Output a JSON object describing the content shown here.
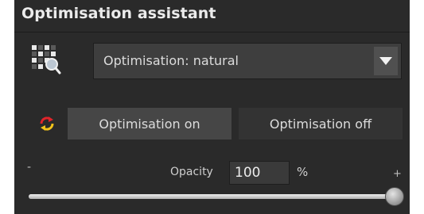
{
  "panel": {
    "title": "Optimisation assistant"
  },
  "mode_selector": {
    "icon": "magnifier-grid-icon",
    "selected": "Optimisation: natural",
    "arrow_icon": "triangle-down-icon"
  },
  "sync_icon": "sync-arrows-icon",
  "buttons": {
    "on_label": "Optimisation on",
    "off_label": "Optimisation off"
  },
  "opacity": {
    "minus": "-",
    "plus": "+",
    "label": "Opacity",
    "value": "100",
    "unit": "%",
    "level_fraction": 1.0
  },
  "colors": {
    "panel_bg": "#2a2a2a",
    "text": "#dcdcdc",
    "sync_red": "#e0242a",
    "sync_yellow": "#f2c31a"
  }
}
